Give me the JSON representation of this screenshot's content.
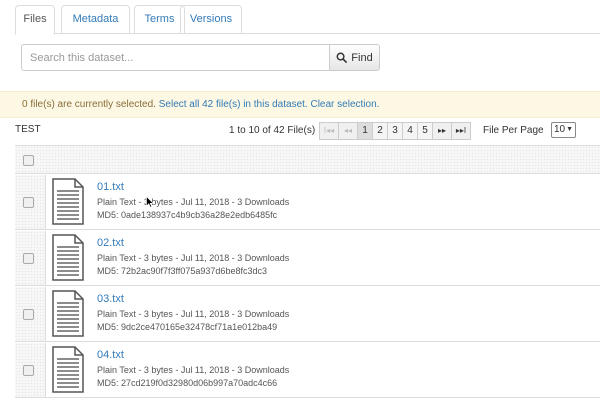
{
  "tabs": [
    "Files",
    "Metadata",
    "Terms",
    "Versions"
  ],
  "search": {
    "placeholder": "Search this dataset...",
    "button_label": "Find"
  },
  "selection": {
    "status": "0 file(s) are currently selected.",
    "select_all": "Select all 42 file(s) in this dataset.",
    "clear": "Clear selection."
  },
  "table": {
    "label": "TEST"
  },
  "pager": {
    "range": "1 to 10 of 42 File(s)",
    "pages": [
      "1",
      "2",
      "3",
      "4",
      "5"
    ],
    "current_page": "1",
    "files_per_page_label": "File Per Page",
    "files_per_page": "10"
  },
  "files": [
    {
      "name": "01.txt",
      "meta": "Plain Text - 3 bytes - Jul 11, 2018 - 3 Downloads",
      "md5": "MD5: 0ade138937c4b9cb36a28e2edb6485fc"
    },
    {
      "name": "02.txt",
      "meta": "Plain Text - 3 bytes - Jul 11, 2018 - 3 Downloads",
      "md5": "MD5: 72b2ac90f7f3ff075a937d6be8fc3dc3"
    },
    {
      "name": "03.txt",
      "meta": "Plain Text - 3 bytes - Jul 11, 2018 - 3 Downloads",
      "md5": "MD5: 9dc2ce470165e32478cf71a1e012ba49"
    },
    {
      "name": "04.txt",
      "meta": "Plain Text - 3 bytes - Jul 11, 2018 - 3 Downloads",
      "md5": "MD5: 27cd219f0d32980d06b997a70adc4c66"
    }
  ],
  "colors": {
    "link": "#337ab7",
    "alert_bg": "#fcf8e3",
    "border": "#dddddd"
  },
  "icons": [
    "search-icon",
    "document-icon",
    "first-page-icon",
    "prev-page-icon",
    "next-page-icon",
    "last-page-icon",
    "mouse-cursor-icon"
  ]
}
